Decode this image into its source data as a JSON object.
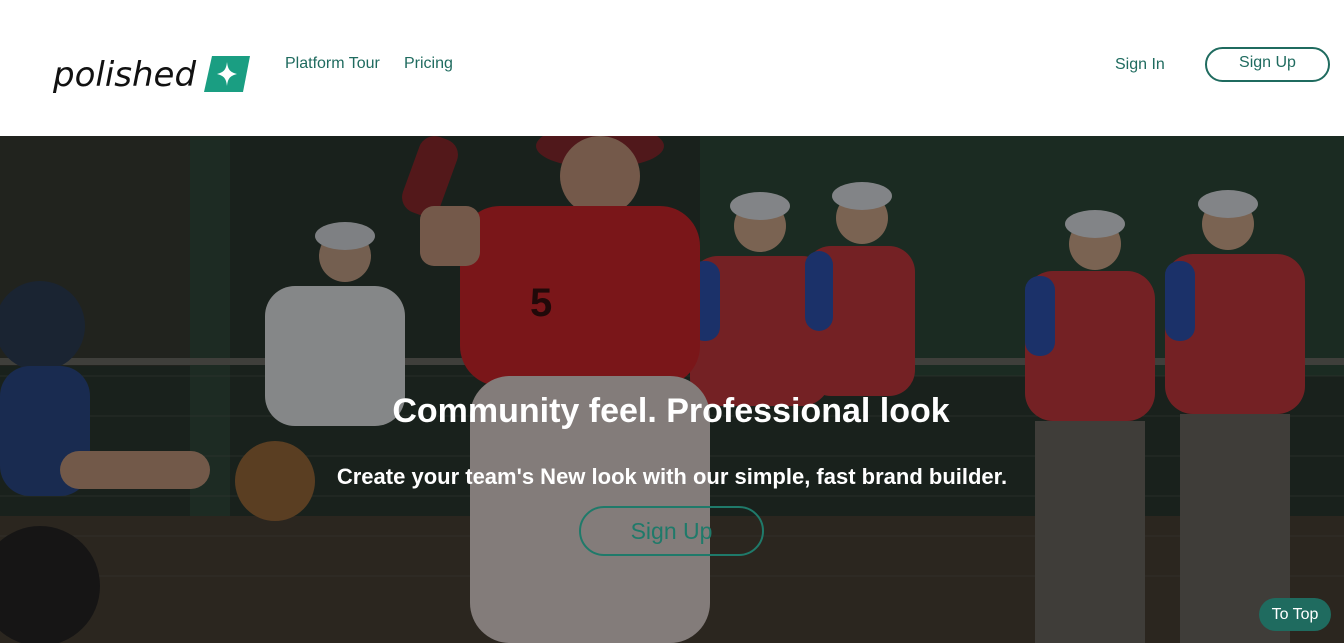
{
  "brand": {
    "name": "polished",
    "icon": "sparkle-icon",
    "accent_color": "#1a9e82"
  },
  "nav": {
    "links": [
      "Platform Tour",
      "Pricing"
    ],
    "sign_in": "Sign In",
    "sign_up": "Sign Up",
    "link_color": "#1f6b5f"
  },
  "hero": {
    "title": "Community feel. Professional look",
    "subtitle": "Create your team's New look with our simple, fast brand builder.",
    "cta": "Sign Up"
  },
  "to_top": "To Top"
}
